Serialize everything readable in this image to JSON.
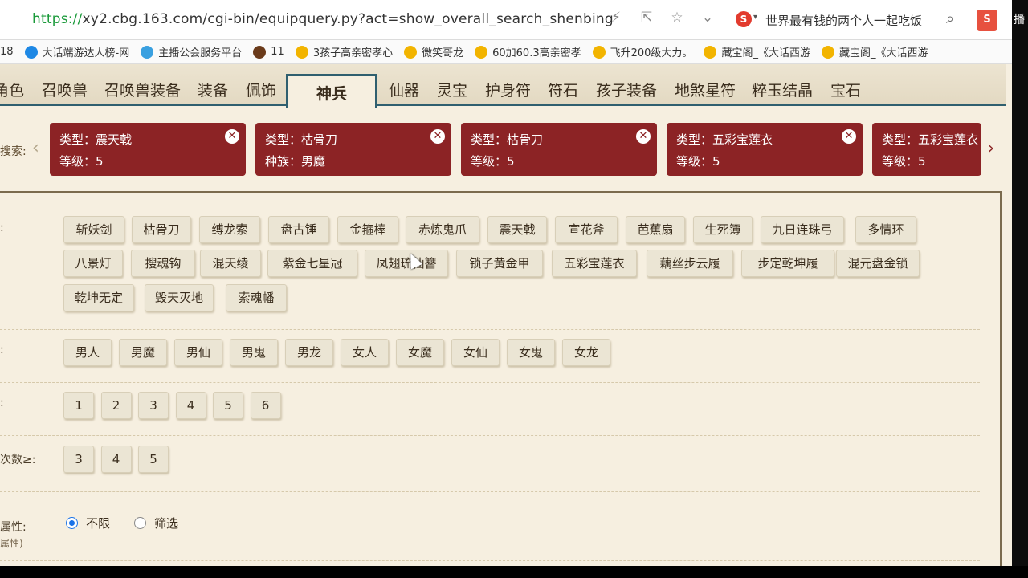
{
  "browser": {
    "url_scheme": "https://",
    "url_rest": "xy2.cbg.163.com/cgi-bin/equipquery.py?act=show_overall_search_shenbing",
    "hot_query": "世界最有钱的两个人一起吃饭",
    "search_engine_badge": "S",
    "ext_badge": "S",
    "right_edge_text": "播"
  },
  "bookmarks": [
    {
      "label": "18",
      "icon": "bookmark-icon",
      "color": "#f0a020"
    },
    {
      "label": "大话端游达人榜-网",
      "icon": "ie-icon",
      "color": "#1e88e5"
    },
    {
      "label": "主播公会服务平台",
      "icon": "globe-icon",
      "color": "#3aa0e0"
    },
    {
      "label": "11",
      "icon": "game-icon",
      "color": "#6a3a1a"
    },
    {
      "label": "3孩子高亲密孝心",
      "icon": "star-icon",
      "color": "#f2b400"
    },
    {
      "label": "微笑哥龙",
      "icon": "star-icon",
      "color": "#f2b400"
    },
    {
      "label": "60加60.3高亲密孝",
      "icon": "star-icon",
      "color": "#f2b400"
    },
    {
      "label": "飞升200级大力。",
      "icon": "star-icon",
      "color": "#f2b400"
    },
    {
      "label": "藏宝阁_《大话西游",
      "icon": "star-icon",
      "color": "#f2b400"
    },
    {
      "label": "藏宝阁_《大话西游",
      "icon": "star-icon",
      "color": "#f2b400"
    }
  ],
  "tabs": [
    "角色",
    "召唤兽",
    "召唤兽装备",
    "装备",
    "佩饰",
    "神兵",
    "仙器",
    "灵宝",
    "护身符",
    "符石",
    "孩子装备",
    "地煞星符",
    "粹玉结晶",
    "宝石"
  ],
  "active_tab": "神兵",
  "history": {
    "label": "搜索:",
    "chips": [
      {
        "line1": "类型：震天戟",
        "line2": "等级：5"
      },
      {
        "line1": "类型：枯骨刀",
        "line2": "种族：男魔"
      },
      {
        "line1": "类型：枯骨刀",
        "line2": "等级：5"
      },
      {
        "line1": "类型：五彩宝莲衣",
        "line2": "等级：5"
      },
      {
        "line1": "类型：五彩宝莲衣",
        "line2": "等级：5"
      }
    ]
  },
  "filters": {
    "type_label": ":",
    "types": [
      "斩妖剑",
      "枯骨刀",
      "缚龙索",
      "盘古锤",
      "金箍棒",
      "赤炼鬼爪",
      "震天戟",
      "宣花斧",
      "芭蕉扇",
      "生死簿",
      "九日连珠弓",
      "多情环",
      "八景灯",
      "搜魂钩",
      "混天绫",
      "紫金七星冠",
      "凤翅琉仙簪",
      "锁子黄金甲",
      "五彩宝莲衣",
      "藕丝步云履",
      "步定乾坤履",
      "混元盘金锁",
      "乾坤无定",
      "毁天灭地",
      "索魂幡"
    ],
    "race_label": ":",
    "races": [
      "男人",
      "男魔",
      "男仙",
      "男鬼",
      "男龙",
      "女人",
      "女魔",
      "女仙",
      "女鬼",
      "女龙"
    ],
    "level_label": ":",
    "levels": [
      "1",
      "2",
      "3",
      "4",
      "5",
      "6"
    ],
    "count_label": "次数≥:",
    "counts": [
      "3",
      "4",
      "5"
    ],
    "attr_label": "属性:",
    "attr_sub_label": "属性)",
    "attr_options": [
      "不限",
      "筛选"
    ],
    "attr_selected": "不限"
  }
}
